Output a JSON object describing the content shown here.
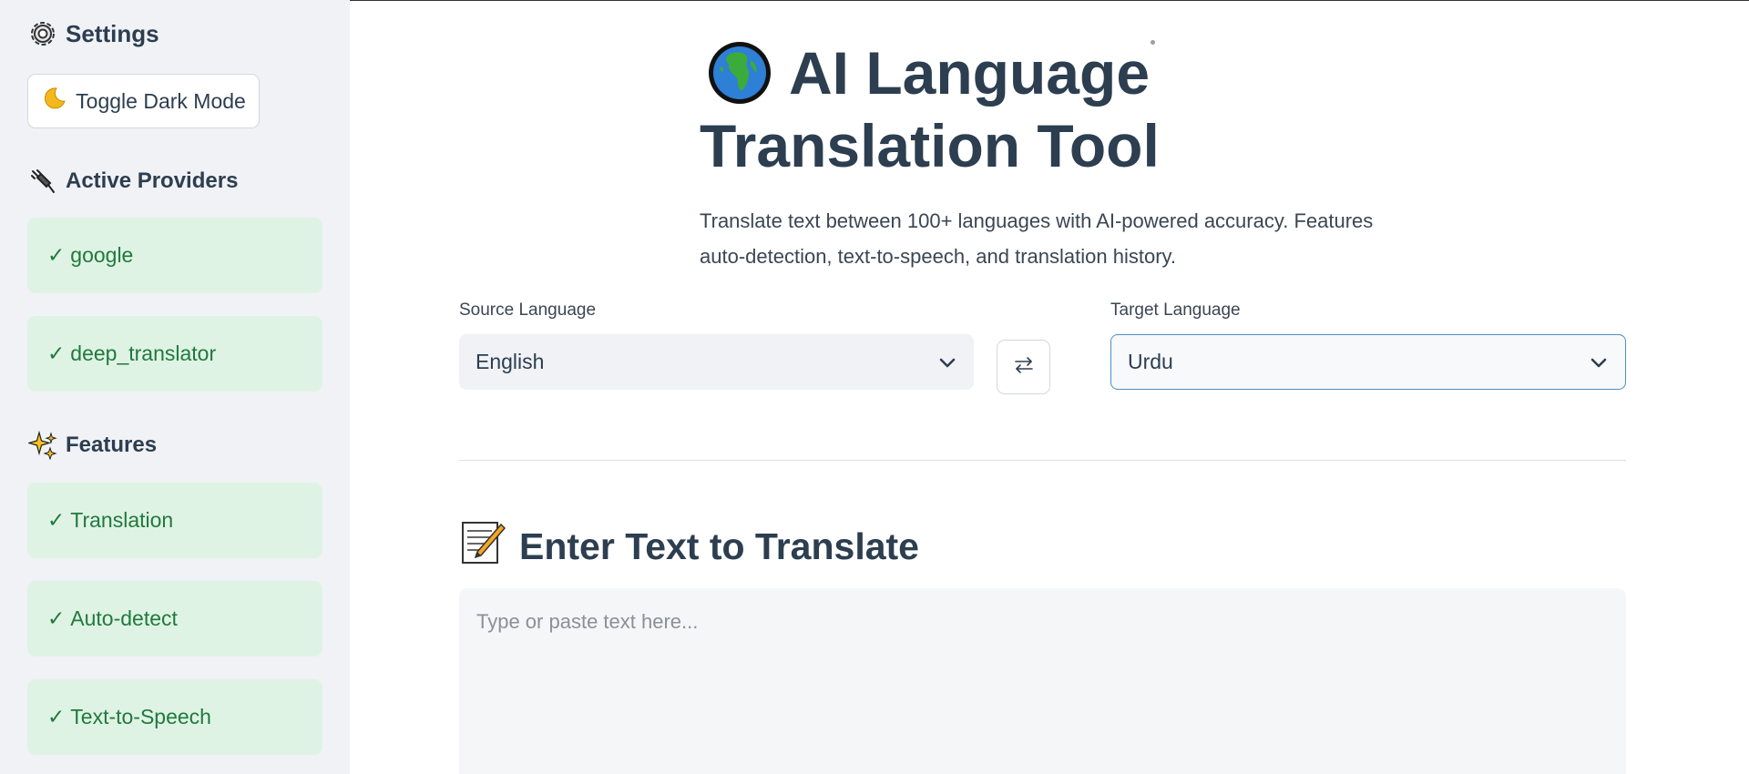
{
  "sidebar": {
    "settings_title": "Settings",
    "toggle_dark_mode_label": "Toggle Dark Mode",
    "active_providers_title": "Active Providers",
    "providers": [
      {
        "label": "google"
      },
      {
        "label": "deep_translator"
      }
    ],
    "features_title": "Features",
    "features": [
      {
        "label": "Translation"
      },
      {
        "label": "Auto-detect"
      },
      {
        "label": "Text-to-Speech"
      }
    ],
    "check_mark": "✓"
  },
  "main": {
    "title_line1": "AI Language",
    "title_line2": "Translation Tool",
    "subtitle_line1": "Translate text between 100+ languages with AI-powered accuracy. Features",
    "subtitle_line2": "auto-detection, text-to-speech, and translation history.",
    "source_language_label": "Source Language",
    "source_language_value": "English",
    "target_language_label": "Target Language",
    "target_language_value": "Urdu",
    "section_title": "Enter Text to Translate",
    "input_placeholder": "Type or paste text here..."
  },
  "icons": {
    "settings": "gear-icon",
    "toggle": "crescent-moon-icon",
    "providers": "plug-icon",
    "features": "sparkles-icon",
    "title": "globe-icon",
    "swap": "swap-arrows-icon",
    "section": "memo-icon",
    "dropdown": "chevron-down-icon"
  },
  "colors": {
    "sidebar_bg": "#f0f2f6",
    "pill_bg": "#dff3e4",
    "pill_text": "#1f7a3d",
    "heading_text": "#2c3e50",
    "target_border": "#4a90c8"
  }
}
